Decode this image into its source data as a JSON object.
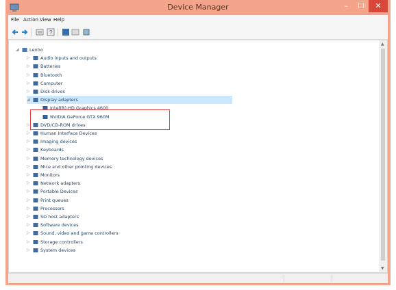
{
  "window": {
    "title": "Device Manager",
    "accent": "#f4a48a",
    "close_color": "#d9473b"
  },
  "title_buttons": {
    "minimize": "–",
    "maximize": "☐",
    "close": "✕"
  },
  "menu": [
    {
      "label": "File"
    },
    {
      "label": "Action"
    },
    {
      "label": "View"
    },
    {
      "label": "Help"
    }
  ],
  "toolbar": [
    {
      "icon": "back-arrow-icon"
    },
    {
      "icon": "forward-arrow-icon"
    },
    {
      "icon": "properties-icon"
    },
    {
      "icon": "help-icon"
    },
    {
      "icon": "update-driver-icon"
    },
    {
      "icon": "show-hidden-icon"
    },
    {
      "icon": "scan-hardware-icon"
    }
  ],
  "tree": {
    "root": "Lenho",
    "expanded_category": "Display adapters",
    "categories": [
      {
        "label": "Audio inputs and outputs",
        "icon": "speaker-icon"
      },
      {
        "label": "Batteries",
        "icon": "battery-icon"
      },
      {
        "label": "Bluetooth",
        "icon": "bluetooth-icon"
      },
      {
        "label": "Computer",
        "icon": "computer-icon"
      },
      {
        "label": "Disk drives",
        "icon": "disk-drive-icon"
      },
      {
        "label": "Display adapters",
        "icon": "display-adapter-icon",
        "expanded": true,
        "children": [
          {
            "label": "Intel(R) HD Graphics 4600",
            "icon": "display-adapter-icon"
          },
          {
            "label": "NVIDIA GeForce GTX 960M",
            "icon": "display-adapter-icon"
          }
        ]
      },
      {
        "label": "DVD/CD-ROM drives",
        "icon": "optical-drive-icon"
      },
      {
        "label": "Human Interface Devices",
        "icon": "hid-icon"
      },
      {
        "label": "Imaging devices",
        "icon": "camera-icon"
      },
      {
        "label": "Keyboards",
        "icon": "keyboard-icon"
      },
      {
        "label": "Memory technology devices",
        "icon": "memory-icon"
      },
      {
        "label": "Mice and other pointing devices",
        "icon": "mouse-icon"
      },
      {
        "label": "Monitors",
        "icon": "monitor-icon"
      },
      {
        "label": "Network adapters",
        "icon": "network-icon"
      },
      {
        "label": "Portable Devices",
        "icon": "portable-device-icon"
      },
      {
        "label": "Print queues",
        "icon": "printer-icon"
      },
      {
        "label": "Processors",
        "icon": "processor-icon"
      },
      {
        "label": "SD host adapters",
        "icon": "sd-card-icon"
      },
      {
        "label": "Software devices",
        "icon": "software-device-icon"
      },
      {
        "label": "Sound, video and game controllers",
        "icon": "sound-icon"
      },
      {
        "label": "Storage controllers",
        "icon": "storage-icon"
      },
      {
        "label": "System devices",
        "icon": "system-device-icon"
      }
    ]
  }
}
